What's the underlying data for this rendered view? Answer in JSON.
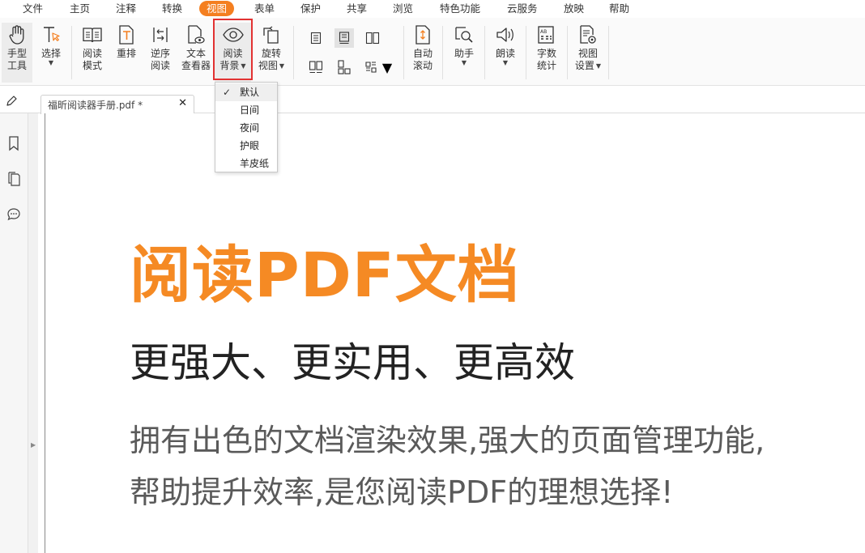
{
  "menu": {
    "items": [
      "文件",
      "主页",
      "注释",
      "转换",
      "视图",
      "表单",
      "保护",
      "共享",
      "浏览",
      "特色功能",
      "云服务",
      "放映",
      "帮助"
    ],
    "active": "视图"
  },
  "toolbar": {
    "hand_tool": [
      "手型",
      "工具"
    ],
    "select": "选择",
    "read_mode": [
      "阅读",
      "模式"
    ],
    "reflow": "重排",
    "reverse_read": [
      "逆序",
      "阅读"
    ],
    "text_viewer": [
      "文本",
      "查看器"
    ],
    "read_background": [
      "阅读",
      "背景"
    ],
    "rotate_view": [
      "旋转",
      "视图"
    ],
    "auto_scroll": [
      "自动",
      "滚动"
    ],
    "assistant": "助手",
    "read_aloud": "朗读",
    "word_count": [
      "字数",
      "统计"
    ],
    "view_settings": [
      "视图",
      "设置"
    ]
  },
  "tab": {
    "title": "福昕阅读器手册.pdf *",
    "close": "✕"
  },
  "dropdown": {
    "items": [
      "默认",
      "日间",
      "夜间",
      "护眼",
      "羊皮纸"
    ],
    "checked": "默认",
    "check_mark": "✓"
  },
  "document": {
    "title": "阅读PDF文档",
    "subtitle": "更强大、更实用、更高效",
    "body_line1": "拥有出色的文档渲染效果,强大的页面管理功能,",
    "body_line2": "帮助提升效率,是您阅读PDF的理想选择!"
  },
  "colors": {
    "accent": "#f47f20",
    "title": "#f58a24",
    "highlight": "#e23232"
  }
}
